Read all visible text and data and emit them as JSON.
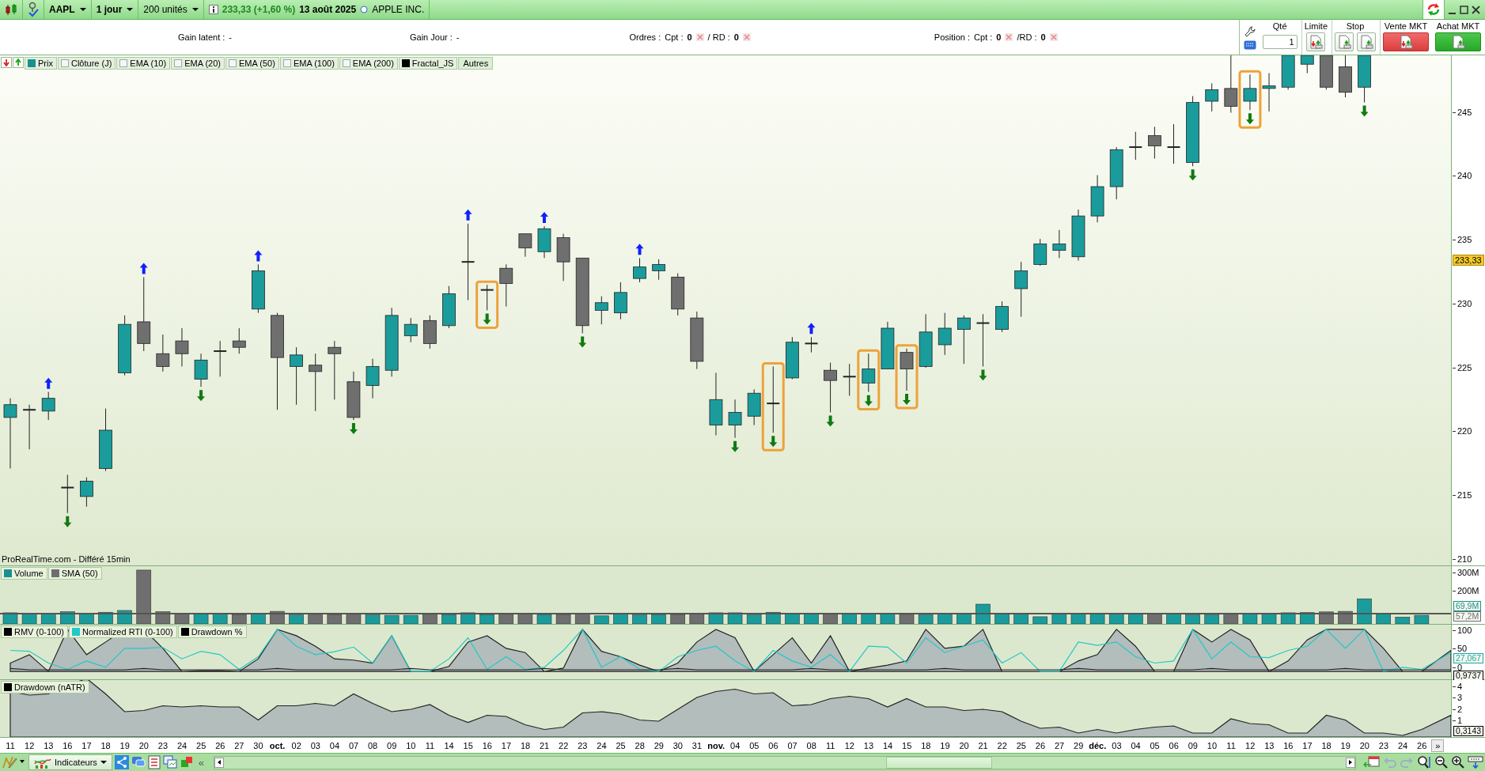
{
  "toolbar": {
    "symbol": "AAPL",
    "period": "1 jour",
    "units": "200 unités",
    "quote": "233,33 (+1,60 %)",
    "date": "13 août 2025",
    "name": "APPLE INC."
  },
  "info_bar": {
    "gain_latent": {
      "label": "Gain latent :",
      "value": "-"
    },
    "gain_jour": {
      "label": "Gain Jour :",
      "value": "-"
    },
    "orders": {
      "label": "Ordres :",
      "cpt_label": "Cpt :",
      "cpt": "0",
      "rd_label": "/ RD :",
      "rd": "0"
    },
    "position": {
      "label": "Position :",
      "cpt_label": "Cpt :",
      "cpt": "0",
      "rd_label": "/RD :",
      "rd": "0"
    }
  },
  "trade_panel": {
    "qty_label": "Qté",
    "qty": "1",
    "limit_label": "Limite",
    "stop_label": "Stop",
    "sell_label": "Vente MKT",
    "buy_label": "Achat MKT"
  },
  "legend": {
    "items": [
      {
        "label": "Prix",
        "checked": true,
        "color": "#1a8f8f"
      },
      {
        "label": "Clôture (J)",
        "checked": false
      },
      {
        "label": "EMA (10)",
        "checked": false
      },
      {
        "label": "EMA (20)",
        "checked": false
      },
      {
        "label": "EMA (50)",
        "checked": false
      },
      {
        "label": "EMA (100)",
        "checked": false
      },
      {
        "label": "EMA (200)",
        "checked": false
      },
      {
        "label": "Fractal_JS",
        "checked": true,
        "color": "#000000"
      }
    ],
    "more": "Autres"
  },
  "price_axis": {
    "ticks": [
      "245",
      "240",
      "235",
      "230",
      "225",
      "220",
      "215",
      "210"
    ],
    "last_price": "233,33"
  },
  "source": "ProRealTime.com - Différé 15min",
  "volume_panel": {
    "legend": [
      {
        "label": "Volume",
        "color": "#1a8f8f"
      },
      {
        "label": "SMA (50)",
        "color": "#6e6e6e"
      }
    ],
    "ticks": [
      "300M",
      "200M"
    ],
    "badges": [
      {
        "text": "69,9M",
        "color": "#1a8f8f"
      },
      {
        "text": "57,2M",
        "color": "#6e6e6e"
      }
    ]
  },
  "oscillator_panel": {
    "legend": [
      {
        "label": "RMV (0-100)",
        "color": "#000000"
      },
      {
        "label": "Normalized RTI (0-100)",
        "color": "#22c8c8"
      },
      {
        "label": "Drawdown %",
        "color": "#000000"
      }
    ],
    "ticks": [
      "100",
      "50",
      "0"
    ],
    "badges": [
      {
        "text": "27,067",
        "color": "#1aa8a8"
      },
      {
        "text": "0,9737",
        "color": "#000000"
      }
    ]
  },
  "drawdown_panel": {
    "legend": [
      {
        "label": "Drawdown (nATR)",
        "color": "#000000"
      }
    ],
    "ticks": [
      "4",
      "3",
      "2",
      "1"
    ],
    "badges": [
      {
        "text": "0,3143",
        "color": "#000000"
      }
    ]
  },
  "x_axis": {
    "labels": [
      {
        "text": "11",
        "kind": "day"
      },
      {
        "text": "12",
        "kind": "day"
      },
      {
        "text": "13",
        "kind": "day"
      },
      {
        "text": "16",
        "kind": "day"
      },
      {
        "text": "17",
        "kind": "day"
      },
      {
        "text": "18",
        "kind": "day"
      },
      {
        "text": "19",
        "kind": "day"
      },
      {
        "text": "20",
        "kind": "day"
      },
      {
        "text": "23",
        "kind": "day"
      },
      {
        "text": "24",
        "kind": "day"
      },
      {
        "text": "25",
        "kind": "day"
      },
      {
        "text": "26",
        "kind": "day"
      },
      {
        "text": "27",
        "kind": "day"
      },
      {
        "text": "30",
        "kind": "day"
      },
      {
        "text": "oct.",
        "kind": "month"
      },
      {
        "text": "02",
        "kind": "day"
      },
      {
        "text": "03",
        "kind": "day"
      },
      {
        "text": "04",
        "kind": "day"
      },
      {
        "text": "07",
        "kind": "day"
      },
      {
        "text": "08",
        "kind": "day"
      },
      {
        "text": "09",
        "kind": "day"
      },
      {
        "text": "10",
        "kind": "day"
      },
      {
        "text": "11",
        "kind": "day"
      },
      {
        "text": "14",
        "kind": "day"
      },
      {
        "text": "15",
        "kind": "day"
      },
      {
        "text": "16",
        "kind": "day"
      },
      {
        "text": "17",
        "kind": "day"
      },
      {
        "text": "18",
        "kind": "day"
      },
      {
        "text": "21",
        "kind": "day"
      },
      {
        "text": "22",
        "kind": "day"
      },
      {
        "text": "23",
        "kind": "day"
      },
      {
        "text": "24",
        "kind": "day"
      },
      {
        "text": "25",
        "kind": "day"
      },
      {
        "text": "28",
        "kind": "day"
      },
      {
        "text": "29",
        "kind": "day"
      },
      {
        "text": "30",
        "kind": "day"
      },
      {
        "text": "31",
        "kind": "day"
      },
      {
        "text": "nov.",
        "kind": "month"
      },
      {
        "text": "04",
        "kind": "day"
      },
      {
        "text": "05",
        "kind": "day"
      },
      {
        "text": "06",
        "kind": "day"
      },
      {
        "text": "07",
        "kind": "day"
      },
      {
        "text": "08",
        "kind": "day"
      },
      {
        "text": "11",
        "kind": "day"
      },
      {
        "text": "12",
        "kind": "day"
      },
      {
        "text": "13",
        "kind": "day"
      },
      {
        "text": "14",
        "kind": "day"
      },
      {
        "text": "15",
        "kind": "day"
      },
      {
        "text": "18",
        "kind": "day"
      },
      {
        "text": "19",
        "kind": "day"
      },
      {
        "text": "20",
        "kind": "day"
      },
      {
        "text": "21",
        "kind": "day"
      },
      {
        "text": "22",
        "kind": "day"
      },
      {
        "text": "25",
        "kind": "day"
      },
      {
        "text": "26",
        "kind": "day"
      },
      {
        "text": "27",
        "kind": "day"
      },
      {
        "text": "29",
        "kind": "day"
      },
      {
        "text": "déc.",
        "kind": "month"
      },
      {
        "text": "03",
        "kind": "day"
      },
      {
        "text": "04",
        "kind": "day"
      },
      {
        "text": "05",
        "kind": "day"
      },
      {
        "text": "06",
        "kind": "day"
      },
      {
        "text": "09",
        "kind": "day"
      },
      {
        "text": "10",
        "kind": "day"
      },
      {
        "text": "11",
        "kind": "day"
      },
      {
        "text": "12",
        "kind": "day"
      },
      {
        "text": "13",
        "kind": "day"
      },
      {
        "text": "16",
        "kind": "day"
      },
      {
        "text": "17",
        "kind": "day"
      },
      {
        "text": "18",
        "kind": "day"
      },
      {
        "text": "19",
        "kind": "day"
      },
      {
        "text": "20",
        "kind": "day"
      },
      {
        "text": "23",
        "kind": "day"
      },
      {
        "text": "24",
        "kind": "day"
      },
      {
        "text": "26",
        "kind": "day"
      }
    ],
    "more": "»"
  },
  "bottom_toolbar": {
    "indicators": "Indicateurs",
    "collapse": "«"
  }
}
